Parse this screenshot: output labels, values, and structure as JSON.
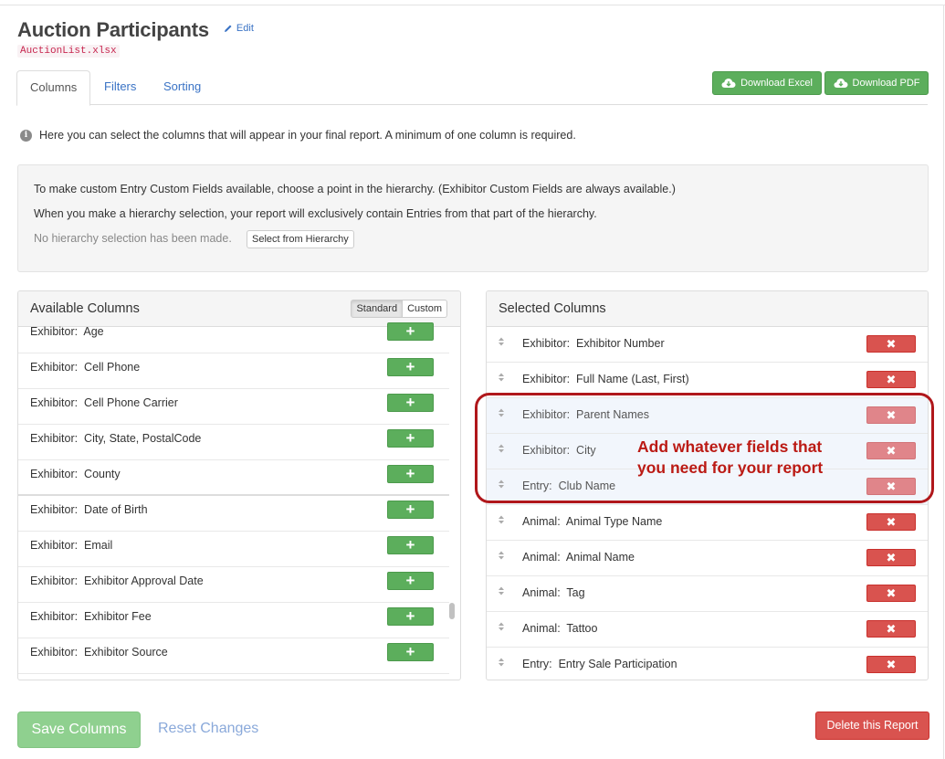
{
  "header": {
    "title": "Auction Participants",
    "edit_label": "Edit",
    "filename": "AuctionList.xlsx"
  },
  "tabs": [
    {
      "label": "Columns",
      "active": true
    },
    {
      "label": "Filters",
      "active": false
    },
    {
      "label": "Sorting",
      "active": false
    }
  ],
  "downloads": {
    "excel_label": "Download Excel",
    "pdf_label": "Download PDF",
    "icon": "cloud-download-icon"
  },
  "info_text": "Here you can select the columns that will appear in your final report. A minimum of one column is required.",
  "hierarchy": {
    "line1": "To make custom Entry Custom Fields available, choose a point in the hierarchy. (Exhibitor Custom Fields are always available.)",
    "line2": "When you make a hierarchy selection, your report will exclusively contain Entries from that part of the hierarchy.",
    "status": "No hierarchy selection has been made.",
    "button_label": "Select from Hierarchy"
  },
  "available": {
    "title": "Available Columns",
    "toggle": {
      "standard": "Standard",
      "custom": "Custom",
      "selected": "Standard"
    },
    "add_symbol": "+",
    "items": [
      {
        "label": "Exhibitor:  Age"
      },
      {
        "label": "Exhibitor:  Cell Phone"
      },
      {
        "label": "Exhibitor:  Cell Phone Carrier"
      },
      {
        "label": "Exhibitor:  City, State, PostalCode"
      },
      {
        "label": "Exhibitor:  County"
      },
      {
        "label": "Exhibitor:  Date of Birth"
      },
      {
        "label": "Exhibitor:  Email"
      },
      {
        "label": "Exhibitor:  Exhibitor Approval Date"
      },
      {
        "label": "Exhibitor:  Exhibitor Fee"
      },
      {
        "label": "Exhibitor:  Exhibitor Source"
      }
    ]
  },
  "selected": {
    "title": "Selected Columns",
    "remove_symbol": "✖",
    "items": [
      {
        "label": "Exhibitor:  Exhibitor Number",
        "highlight": false
      },
      {
        "label": "Exhibitor:  Full Name (Last, First)",
        "highlight": false
      },
      {
        "label": "Exhibitor:  Parent Names",
        "highlight": true
      },
      {
        "label": "Exhibitor:  City",
        "highlight": true
      },
      {
        "label": "Entry:  Club Name",
        "highlight": true
      },
      {
        "label": "Animal:  Animal Type Name",
        "highlight": false
      },
      {
        "label": "Animal:  Animal Name",
        "highlight": false
      },
      {
        "label": "Animal:  Tag",
        "highlight": false
      },
      {
        "label": "Animal:  Tattoo",
        "highlight": false
      },
      {
        "label": "Entry:  Entry Sale Participation",
        "highlight": false
      }
    ]
  },
  "annotation": {
    "line1": "Add whatever fields that",
    "line2": "you need for your report",
    "color": "#bb1a14"
  },
  "footer": {
    "save_label": "Save Columns",
    "reset_label": "Reset Changes",
    "delete_label": "Delete this Report"
  },
  "colors": {
    "link": "#3a73c5",
    "success": "#5cae5c",
    "danger": "#d9534f"
  }
}
